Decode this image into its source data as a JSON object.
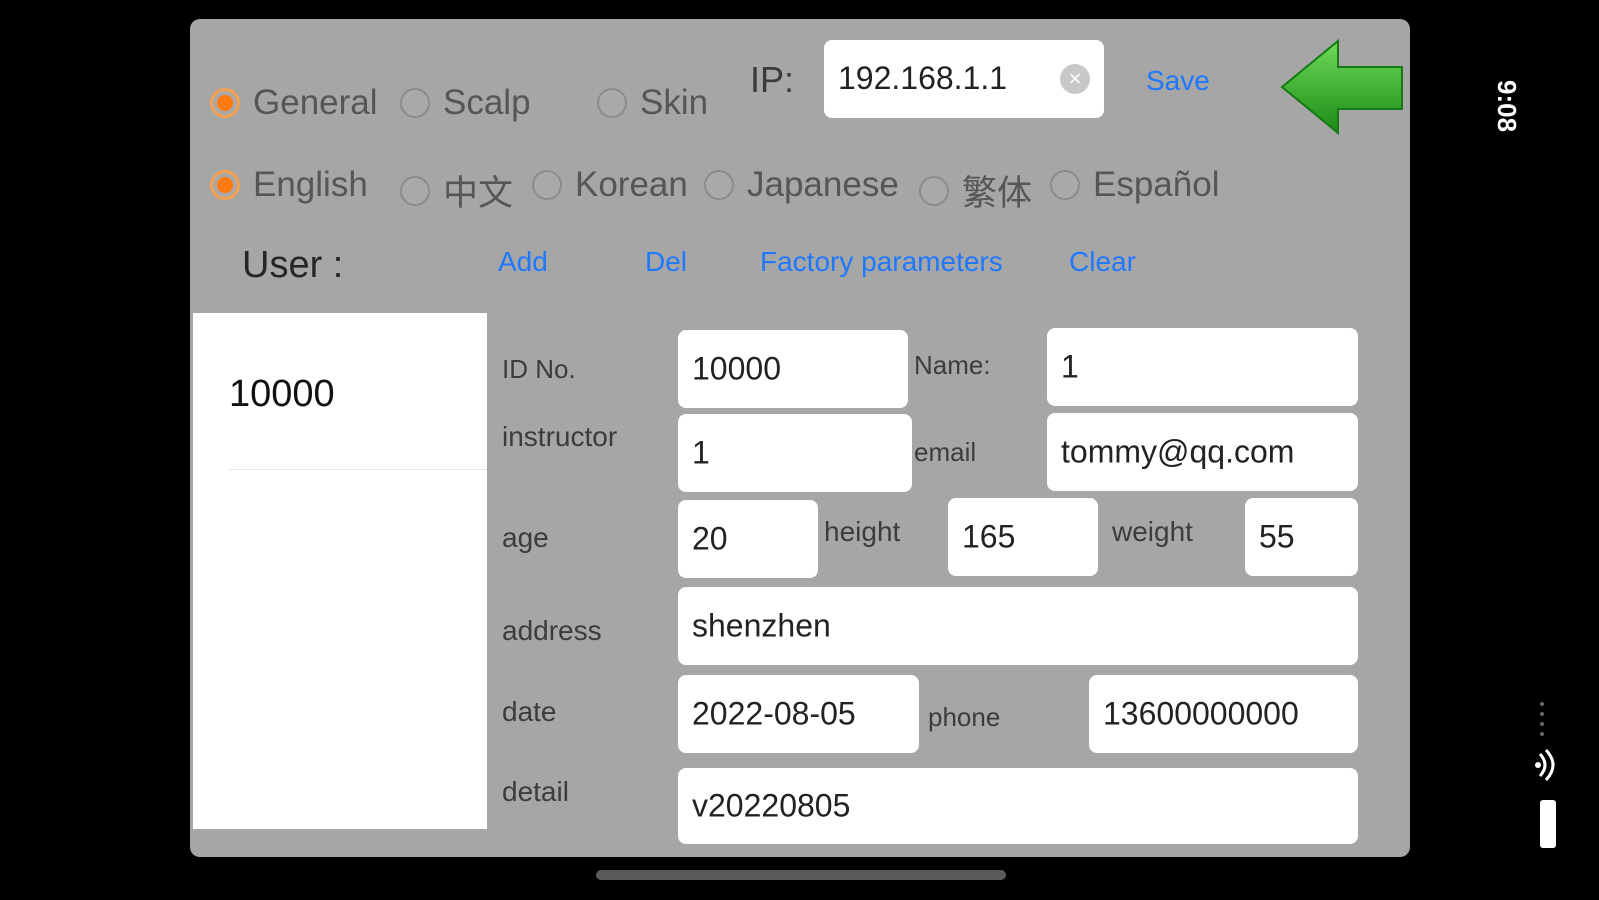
{
  "status_bar": {
    "time": "9:08"
  },
  "mode_options": [
    {
      "label": "General",
      "selected": true
    },
    {
      "label": "Scalp",
      "selected": false
    },
    {
      "label": "Skin",
      "selected": false
    }
  ],
  "language_options": [
    {
      "label": "English",
      "selected": true
    },
    {
      "label": "中文",
      "selected": false
    },
    {
      "label": "Korean",
      "selected": false
    },
    {
      "label": "Japanese",
      "selected": false
    },
    {
      "label": "繁体",
      "selected": false
    },
    {
      "label": "Español",
      "selected": false
    }
  ],
  "ip": {
    "label": "IP:",
    "value": "192.168.1.1"
  },
  "toolbar": {
    "save_label": "Save",
    "user_label": "User :",
    "add_label": "Add",
    "del_label": "Del",
    "factory_label": "Factory parameters",
    "clear_label": "Clear"
  },
  "user_list": [
    "10000"
  ],
  "form": {
    "id_no": {
      "label": "ID No.",
      "value": "10000"
    },
    "name": {
      "label": "Name:",
      "value": "1"
    },
    "instructor": {
      "label": "instructor",
      "value": "1"
    },
    "email": {
      "label": "email",
      "value": "tommy@qq.com"
    },
    "age": {
      "label": "age",
      "value": "20"
    },
    "height": {
      "label": "height",
      "value": "165"
    },
    "weight": {
      "label": "weight",
      "value": "55"
    },
    "address": {
      "label": "address",
      "value": "shenzhen"
    },
    "date": {
      "label": "date",
      "value": "2022-08-05"
    },
    "phone": {
      "label": "phone",
      "value": "13600000000"
    },
    "detail": {
      "label": "detail",
      "value": "v20220805"
    }
  },
  "colors": {
    "panel_bg": "#a6a6a6",
    "radio_selected": "#ff7a10",
    "link": "#1f78ff",
    "back_arrow": "#22a31a"
  }
}
